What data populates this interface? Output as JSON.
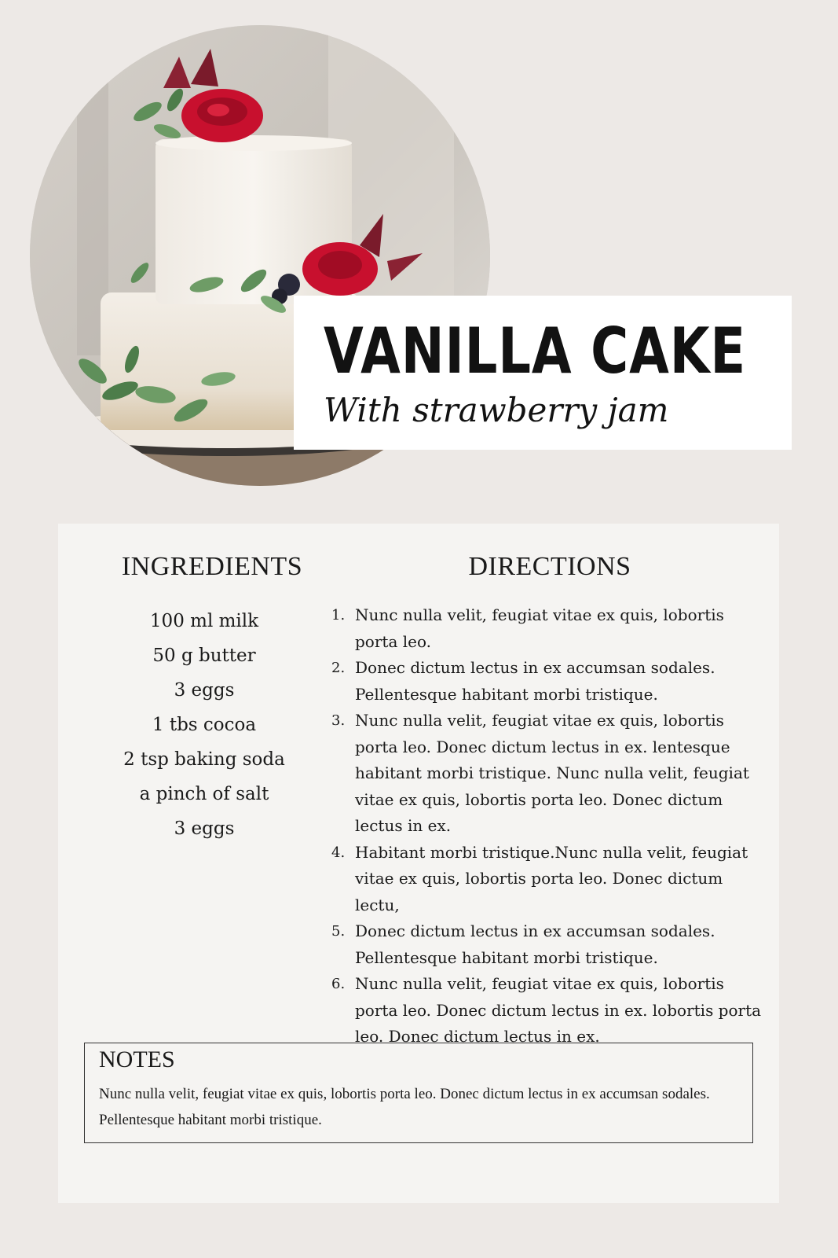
{
  "header": {
    "title": "VANILLA CAKE",
    "subtitle": "With strawberry jam"
  },
  "ingredients": {
    "heading": "INGREDIENTS",
    "items": [
      "100 ml milk",
      "50 g butter",
      "3 eggs",
      "1 tbs cocoa",
      "2 tsp baking soda",
      "a pinch of salt",
      "3 eggs"
    ]
  },
  "directions": {
    "heading": "DIRECTIONS",
    "steps": [
      {
        "num": "1.",
        "text": "Nunc nulla velit, feugiat vitae ex quis, lobortis porta leo."
      },
      {
        "num": "2.",
        "text": "Donec dictum lectus in ex accumsan sodales. Pellentesque habitant morbi tristique."
      },
      {
        "num": "3.",
        "text": "Nunc nulla velit, feugiat vitae ex quis, lobortis porta leo. Donec dictum lectus in ex. lentesque habitant morbi tristique. Nunc nulla velit, feugiat vitae ex quis, lobortis porta leo. Donec dictum lectus in ex."
      },
      {
        "num": "4.",
        "text": "Habitant morbi tristique.Nunc nulla velit, feugiat vitae ex quis, lobortis porta leo. Donec dictum lectu,"
      },
      {
        "num": "5.",
        "text": "Donec dictum lectus in ex accumsan sodales. Pellentesque habitant morbi tristique."
      },
      {
        "num": "6.",
        "text": "Nunc nulla velit, feugiat vitae ex quis, lobortis porta leo. Donec dictum lectus in ex. lobortis porta leo. Donec dictum lectus in ex."
      }
    ]
  },
  "notes": {
    "heading": "NOTES",
    "text": "Nunc nulla velit, feugiat vitae ex quis, lobortis porta leo. Donec dictum lectus in ex accumsan sodales. Pellentesque habitant morbi tristique."
  },
  "colors": {
    "page_background": "#ede9e6",
    "card_background": "#f5f4f2",
    "title_card": "#ffffff",
    "flower_red": "#c8102e",
    "leaf_green": "#5f8f5a"
  }
}
